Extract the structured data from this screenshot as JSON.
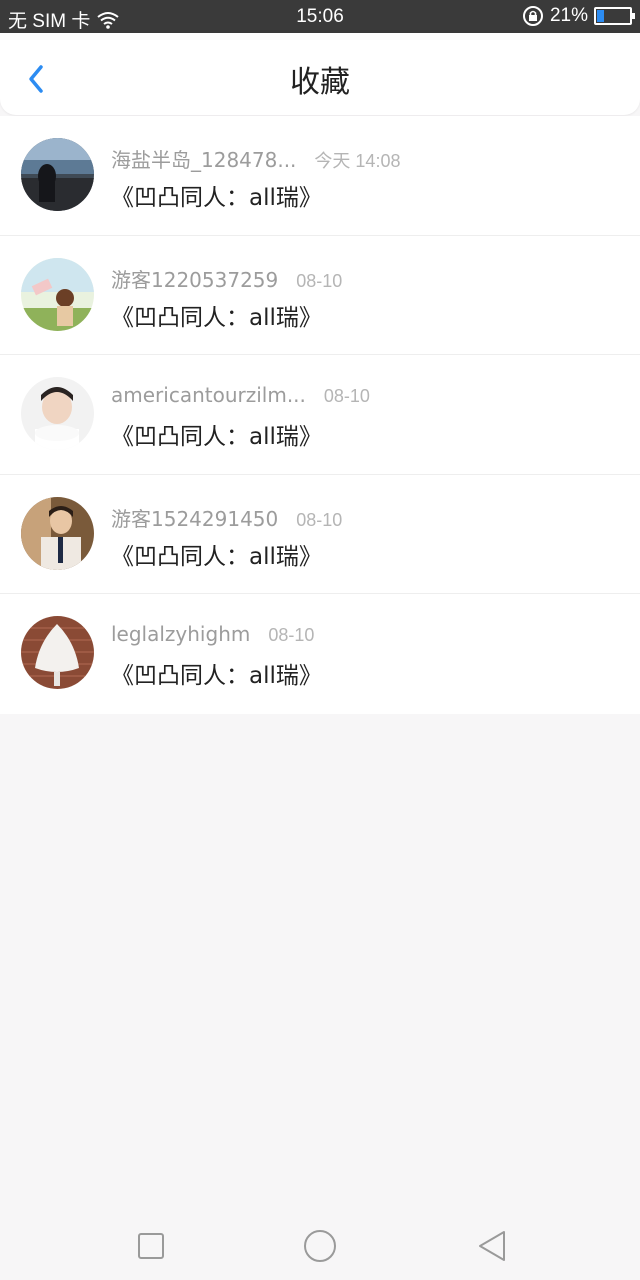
{
  "status_bar": {
    "carrier": "无 SIM 卡",
    "time": "15:06",
    "battery_percent": "21%",
    "battery_level": 0.21
  },
  "header": {
    "title": "收藏"
  },
  "favorites": [
    {
      "username": "海盐半岛_128478...",
      "date": "今天 14:08",
      "title": "《凹凸同人：all瑞》"
    },
    {
      "username": "游客1220537259",
      "date": "08-10",
      "title": "《凹凸同人：all瑞》"
    },
    {
      "username": "americantourzilm...",
      "date": "08-10",
      "title": "《凹凸同人：all瑞》"
    },
    {
      "username": "游客1524291450",
      "date": "08-10",
      "title": "《凹凸同人：all瑞》"
    },
    {
      "username": "leglalzyhighm",
      "date": "08-10",
      "title": "《凹凸同人：all瑞》"
    }
  ],
  "colors": {
    "accent": "#2c8cf2",
    "background": "#f7f6f7",
    "status_bar": "#3a3a3a"
  },
  "icons": {
    "back": "chevron-left-icon",
    "wifi": "wifi-icon",
    "lock": "rotation-lock-icon",
    "battery": "battery-icon",
    "nav_recent": "square-icon",
    "nav_home": "circle-icon",
    "nav_back": "triangle-back-icon"
  }
}
